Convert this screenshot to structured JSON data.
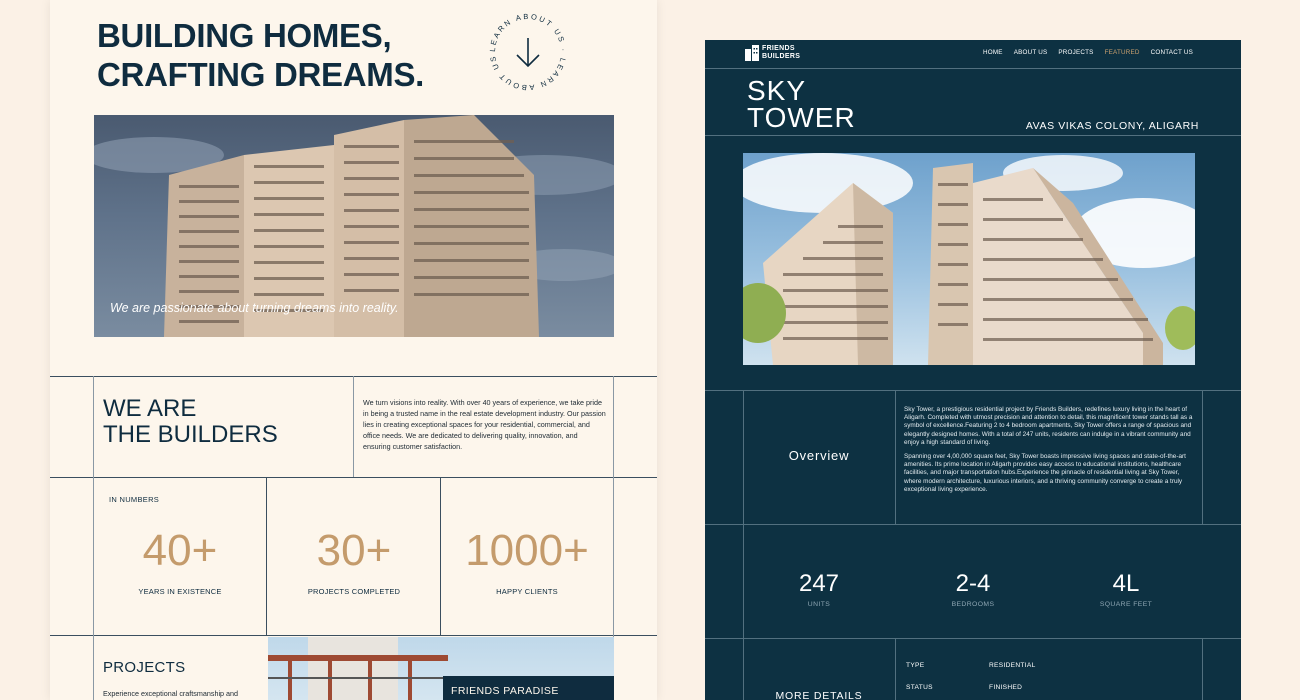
{
  "left": {
    "hero_title": "BUILDING HOMES,\nCRAFTING DREAMS.",
    "badge_text": "LEARN ABOUT US · LEARN ABOUT US ·",
    "hero_caption": "We are passionate about turning dreams into reality.",
    "builders_title": "WE ARE\nTHE BUILDERS",
    "builders_text": "We turn visions into reality. With over 40 years of experience, we take pride in being a trusted name in the real estate development industry. Our passion lies in creating exceptional spaces for your residential, commercial, and office needs. We are dedicated to delivering quality, innovation, and ensuring customer satisfaction.",
    "numbers_label": "IN NUMBERS",
    "stats": [
      {
        "value": "40+",
        "label": "YEARS IN EXISTENCE"
      },
      {
        "value": "30+",
        "label": "PROJECTS COMPLETED"
      },
      {
        "value": "1000+",
        "label": "HAPPY CLIENTS"
      }
    ],
    "projects_title": "PROJECTS",
    "projects_text": "Experience exceptional craftsmanship and",
    "project_caption": "FRIENDS PARADISE"
  },
  "right": {
    "logo_text": "FRIENDS\nBUILDERS",
    "nav": [
      "HOME",
      "ABOUT US",
      "PROJECTS",
      "FEATURED",
      "CONTACT US"
    ],
    "nav_active": "FEATURED",
    "title": "SKY\nTOWER",
    "location": "AVAS VIKAS COLONY, ALIGARH",
    "overview_label": "Overview",
    "overview_p1": "Sky Tower, a prestigious residential project by Friends Builders, redefines luxury living in the heart of Aligarh. Completed with utmost precision and attention to detail, this magnificent tower stands tall as a symbol of excellence.Featuring 2 to 4 bedroom apartments, Sky Tower offers a range of spacious and elegantly designed homes. With a total of 247 units, residents can indulge in a vibrant community and enjoy a high standard of living.",
    "overview_p2": "Spanning over 4,00,000 square feet, Sky Tower boasts impressive living spaces and state-of-the-art amenities. Its prime location in Aligarh provides easy access to educational institutions, healthcare facilities, and major transportation hubs.Experience the pinnacle of residential living at Sky Tower, where modern architecture, luxurious interiors, and a thriving community converge to create a truly exceptional living experience.",
    "stats": [
      {
        "value": "247",
        "label": "UNITS"
      },
      {
        "value": "2-4",
        "label": "BEDROOMS"
      },
      {
        "value": "4L",
        "label": "SQUARE FEET"
      }
    ],
    "details_label": "MORE DETAILS",
    "details": [
      {
        "key": "TYPE",
        "value": "RESIDENTIAL"
      },
      {
        "key": "STATUS",
        "value": "FINISHED"
      }
    ]
  },
  "colors": {
    "navy": "#0f2c3f",
    "cream": "#fdf6ec",
    "accent_gold": "#c49b6c",
    "right_bg": "#0d3142",
    "nav_active": "#c9a06e"
  },
  "icons": [
    "arrow-down-icon",
    "logo-icon"
  ]
}
